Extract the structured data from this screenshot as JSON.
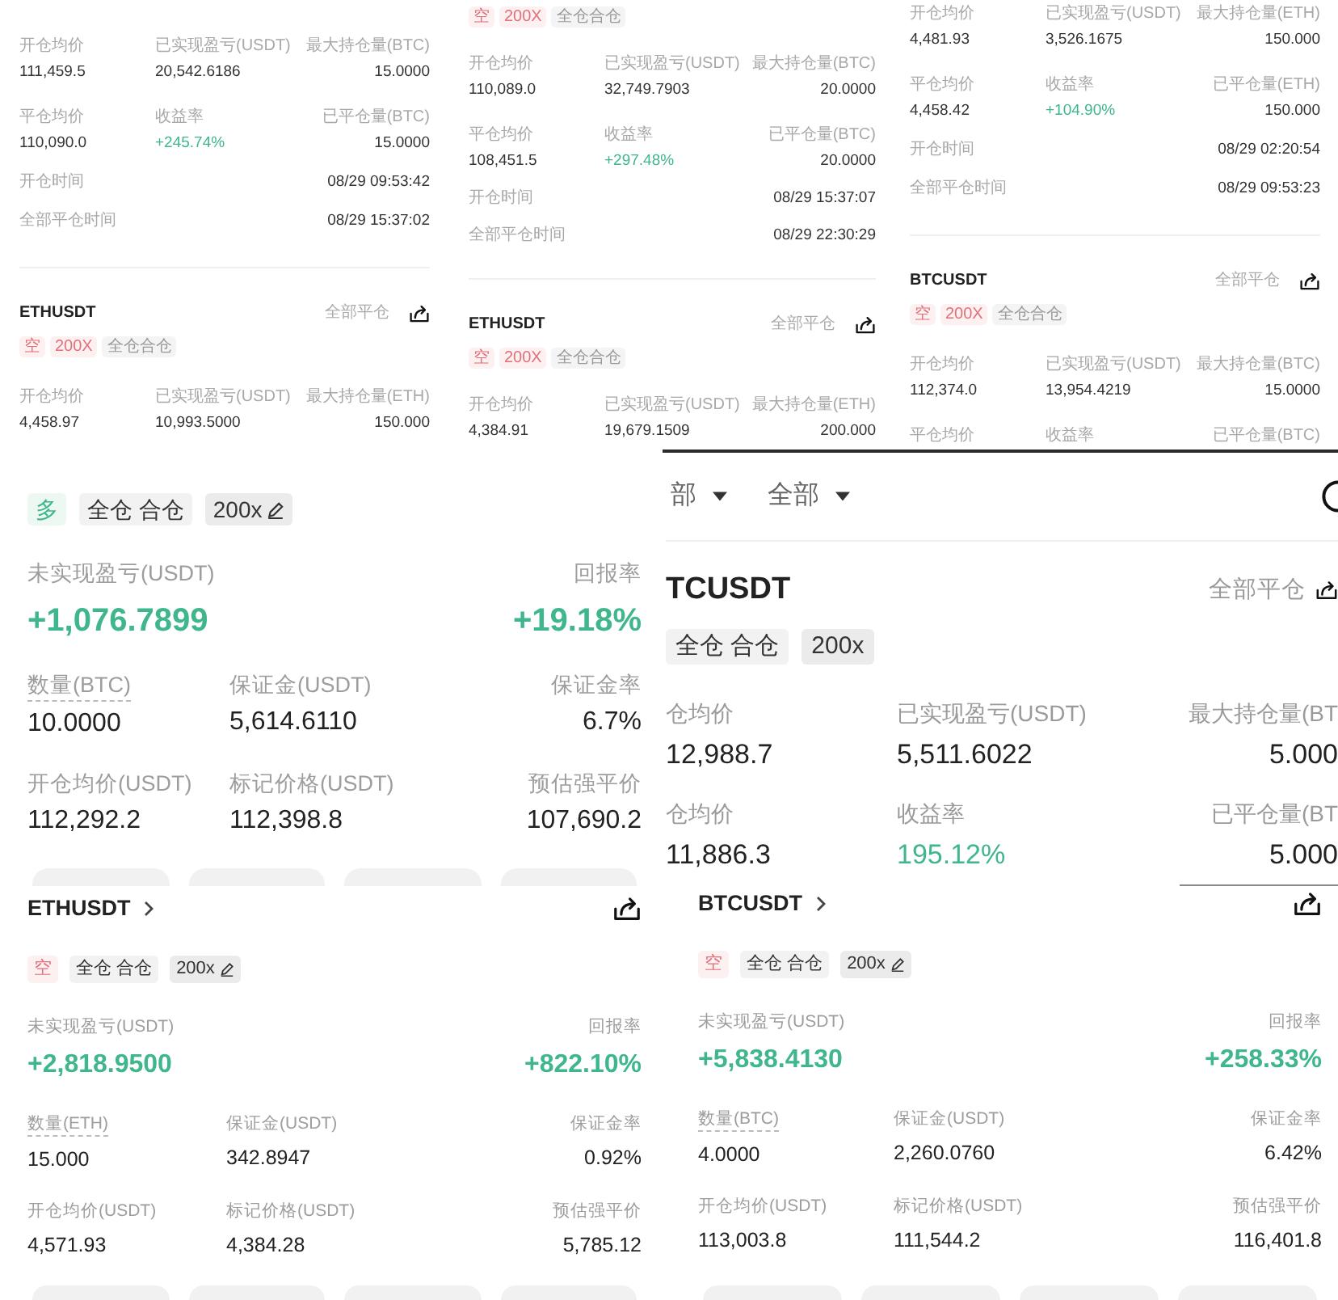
{
  "rows": [
    {
      "panels": [
        {
          "kind": "history",
          "sections": [
            {
              "stat_rows": [
                [
                  {
                    "label": "开仓均价",
                    "value": "111,459.5"
                  },
                  {
                    "label": "已实现盈亏(USDT)",
                    "value": "20,542.6186"
                  },
                  {
                    "label": "最大持仓量(BTC)",
                    "value": "15.0000"
                  }
                ],
                [
                  {
                    "label": "平仓均价",
                    "value": "110,090.0"
                  },
                  {
                    "label": "收益率",
                    "value": "+245.74%",
                    "color": "#3fb68b"
                  },
                  {
                    "label": "已平仓量(BTC)",
                    "value": "15.0000"
                  }
                ]
              ],
              "times": [
                {
                  "label": "开仓时间",
                  "value": "08/29 09:53:42"
                },
                {
                  "label": "全部平仓时间",
                  "value": "08/29 15:37:02"
                }
              ]
            },
            {
              "symbol": "ETHUSDT",
              "close_all": "全部平仓",
              "tags": [
                {
                  "label": "空",
                  "kind": "short"
                },
                {
                  "label": "200X",
                  "kind": "short"
                },
                {
                  "label": "全仓合仓",
                  "kind": "mode"
                }
              ],
              "stat_rows": [
                [
                  {
                    "label": "开仓均价",
                    "value": "4,458.97"
                  },
                  {
                    "label": "已实现盈亏(USDT)",
                    "value": "10,993.5000"
                  },
                  {
                    "label": "最大持仓量(ETH)",
                    "value": "150.000"
                  }
                ]
              ]
            }
          ]
        },
        {
          "kind": "history",
          "sections": [
            {
              "tags": [
                {
                  "label": "空",
                  "kind": "short"
                },
                {
                  "label": "200X",
                  "kind": "short"
                },
                {
                  "label": "全仓合仓",
                  "kind": "mode"
                }
              ],
              "stat_rows": [
                [
                  {
                    "label": "开仓均价",
                    "value": "110,089.0"
                  },
                  {
                    "label": "已实现盈亏(USDT)",
                    "value": "32,749.7903"
                  },
                  {
                    "label": "最大持仓量(BTC)",
                    "value": "20.0000"
                  }
                ],
                [
                  {
                    "label": "平仓均价",
                    "value": "108,451.5"
                  },
                  {
                    "label": "收益率",
                    "value": "+297.48%",
                    "color": "#3fb68b"
                  },
                  {
                    "label": "已平仓量(BTC)",
                    "value": "20.0000"
                  }
                ]
              ],
              "times": [
                {
                  "label": "开仓时间",
                  "value": "08/29 15:37:07"
                },
                {
                  "label": "全部平仓时间",
                  "value": "08/29 22:30:29"
                }
              ]
            },
            {
              "symbol": "ETHUSDT",
              "close_all": "全部平仓",
              "tags": [
                {
                  "label": "空",
                  "kind": "short"
                },
                {
                  "label": "200X",
                  "kind": "short"
                },
                {
                  "label": "全仓合仓",
                  "kind": "mode"
                }
              ],
              "stat_rows": [
                [
                  {
                    "label": "开仓均价",
                    "value": "4,384.91"
                  },
                  {
                    "label": "已实现盈亏(USDT)",
                    "value": "19,679.1509"
                  },
                  {
                    "label": "最大持仓量(ETH)",
                    "value": "200.000"
                  }
                ]
              ]
            }
          ]
        },
        {
          "kind": "history",
          "sections": [
            {
              "stat_rows": [
                [
                  {
                    "label": "开仓均价",
                    "value": "4,481.93"
                  },
                  {
                    "label": "已实现盈亏(USDT)",
                    "value": "3,526.1675"
                  },
                  {
                    "label": "最大持仓量(ETH)",
                    "value": "150.000"
                  }
                ],
                [
                  {
                    "label": "平仓均价",
                    "value": "4,458.42"
                  },
                  {
                    "label": "收益率",
                    "value": "+104.90%",
                    "color": "#3fb68b"
                  },
                  {
                    "label": "已平仓量(ETH)",
                    "value": "150.000"
                  }
                ]
              ],
              "times": [
                {
                  "label": "开仓时间",
                  "value": "08/29 02:20:54"
                },
                {
                  "label": "全部平仓时间",
                  "value": "08/29 09:53:23"
                }
              ]
            },
            {
              "symbol": "BTCUSDT",
              "close_all": "全部平仓",
              "tags": [
                {
                  "label": "空",
                  "kind": "short"
                },
                {
                  "label": "200X",
                  "kind": "short"
                },
                {
                  "label": "全仓合仓",
                  "kind": "mode"
                }
              ],
              "stat_rows": [
                [
                  {
                    "label": "开仓均价",
                    "value": "112,374.0"
                  },
                  {
                    "label": "已实现盈亏(USDT)",
                    "value": "13,954.4219"
                  },
                  {
                    "label": "最大持仓量(BTC)",
                    "value": "15.0000"
                  }
                ],
                [
                  {
                    "label": "平仓均价"
                  },
                  {
                    "label": "收益率"
                  },
                  {
                    "label": "已平仓量(BTC)"
                  }
                ]
              ]
            }
          ]
        }
      ]
    },
    {
      "panels": [
        {
          "kind": "position",
          "tags": [
            {
              "label": "多",
              "kind": "long"
            },
            {
              "label": "全仓 合仓",
              "kind": "mode"
            },
            {
              "label": "200x",
              "kind": "leverage_edit"
            }
          ],
          "pnl": [
            {
              "label": "未实现盈亏(USDT)",
              "value": "+1,076.7899",
              "color": "#3fb68b"
            },
            {
              "label": "回报率",
              "value": "+19.18%",
              "color": "#3fb68b"
            }
          ],
          "stat_rows": [
            [
              {
                "label": "数量(BTC)",
                "value": "10.0000",
                "hint": true
              },
              {
                "label": "保证金(USDT)",
                "value": "5,614.6110"
              },
              {
                "label": "保证金率",
                "value": "6.7%"
              }
            ],
            [
              {
                "label": "开仓均价(USDT)",
                "value": "112,292.2"
              },
              {
                "label": "标记价格(USDT)",
                "value": "112,398.8"
              },
              {
                "label": "预估强平价",
                "value": "107,690.2"
              }
            ]
          ],
          "action_bar": true
        },
        {
          "kind": "history",
          "filters": [
            "部",
            "全部"
          ],
          "sections": [
            {
              "symbol": "TCUSDT",
              "close_all": "全部平仓",
              "tags": [
                {
                  "label": "全仓 合仓",
                  "kind": "mode"
                },
                {
                  "label": "200x",
                  "kind": "leverage"
                }
              ],
              "stat_rows": [
                [
                  {
                    "label": "仓均价",
                    "value": "12,988.7"
                  },
                  {
                    "label": "已实现盈亏(USDT)",
                    "value": "5,511.6022"
                  },
                  {
                    "label": "最大持仓量(BT",
                    "value": "5.000"
                  }
                ],
                [
                  {
                    "label": "仓均价",
                    "value": "11,886.3"
                  },
                  {
                    "label": "收益率",
                    "value": "195.12%",
                    "color": "#3fb68b"
                  },
                  {
                    "label": "已平仓量(BT",
                    "value": "5.000"
                  }
                ]
              ]
            }
          ]
        }
      ]
    },
    {
      "panels": [
        {
          "kind": "position",
          "symbol": "ETHUSDT",
          "tags": [
            {
              "label": "空",
              "kind": "short"
            },
            {
              "label": "全仓 合仓",
              "kind": "mode"
            },
            {
              "label": "200x",
              "kind": "leverage_edit"
            }
          ],
          "pnl": [
            {
              "label": "未实现盈亏(USDT)",
              "value": "+2,818.9500",
              "color": "#3fb68b"
            },
            {
              "label": "回报率",
              "value": "+822.10%",
              "color": "#3fb68b"
            }
          ],
          "stat_rows": [
            [
              {
                "label": "数量(ETH)",
                "value": "15.000",
                "hint": true
              },
              {
                "label": "保证金(USDT)",
                "value": "342.8947"
              },
              {
                "label": "保证金率",
                "value": "0.92%"
              }
            ],
            [
              {
                "label": "开仓均价(USDT)",
                "value": "4,571.93"
              },
              {
                "label": "标记价格(USDT)",
                "value": "4,384.28"
              },
              {
                "label": "预估强平价",
                "value": "5,785.12"
              }
            ]
          ],
          "action_bar": true
        },
        {
          "kind": "position",
          "symbol": "BTCUSDT",
          "tags": [
            {
              "label": "空",
              "kind": "short"
            },
            {
              "label": "全仓 合仓",
              "kind": "mode"
            },
            {
              "label": "200x",
              "kind": "leverage_edit"
            }
          ],
          "pnl": [
            {
              "label": "未实现盈亏(USDT)",
              "value": "+5,838.4130",
              "color": "#3fb68b"
            },
            {
              "label": "回报率",
              "value": "+258.33%",
              "color": "#3fb68b"
            }
          ],
          "stat_rows": [
            [
              {
                "label": "数量(BTC)",
                "value": "4.0000",
                "hint": true
              },
              {
                "label": "保证金(USDT)",
                "value": "2,260.0760"
              },
              {
                "label": "保证金率",
                "value": "6.42%"
              }
            ],
            [
              {
                "label": "开仓均价(USDT)",
                "value": "113,003.8"
              },
              {
                "label": "标记价格(USDT)",
                "value": "111,544.2"
              },
              {
                "label": "预估强平价",
                "value": "116,401.8"
              }
            ]
          ],
          "action_bar": true
        }
      ]
    }
  ]
}
